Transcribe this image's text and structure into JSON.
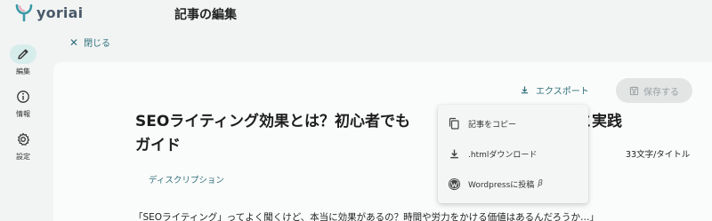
{
  "app": {
    "name": "yoriai",
    "page_title": "記事の編集"
  },
  "sidebar": {
    "items": [
      {
        "label": "編集",
        "icon": "pencil-icon",
        "active": true
      },
      {
        "label": "情報",
        "icon": "info-icon",
        "active": false
      },
      {
        "label": "設定",
        "icon": "gear-icon",
        "active": false
      }
    ]
  },
  "close": {
    "label": "閉じる"
  },
  "toolbar": {
    "export_label": "エクスポート",
    "save_label": "保存する"
  },
  "article": {
    "title": "SEOライティング効果とは？初心者でも　　　　　　　　　　　と実践ガイド",
    "char_count": "33文字/タイトル",
    "description_label": "ディスクリプション",
    "body_preview": "「SEOライティング」ってよく聞くけど、本当に効果があるの？時間や労力をかける価値はあるんだろうか…」"
  },
  "export_menu": {
    "items": [
      {
        "label": "記事をコピー",
        "icon": "copy-icon"
      },
      {
        "label": ".htmlダウンロード",
        "icon": "download-icon"
      },
      {
        "label": "Wordpressに投稿",
        "icon": "wordpress-icon",
        "badge": "β"
      }
    ]
  },
  "colors": {
    "accent": "#2f6f7a",
    "active_bg": "#d7edeb",
    "disabled_bg": "#e3e5e5"
  }
}
